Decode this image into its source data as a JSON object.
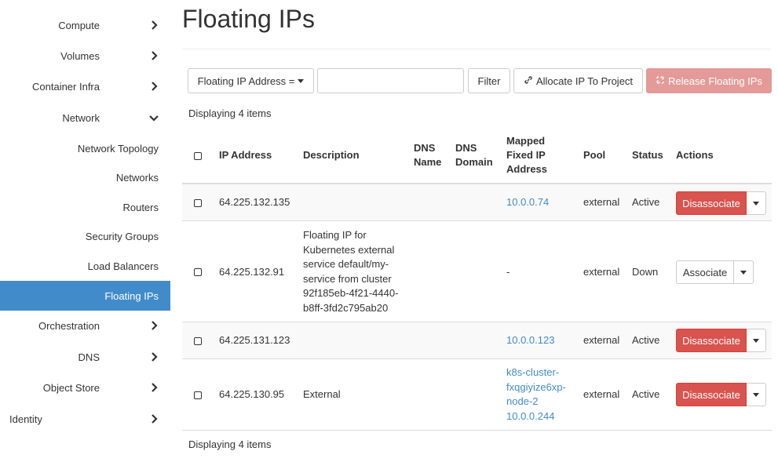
{
  "sidebar": {
    "items": [
      {
        "label": "Compute",
        "chevron": "right"
      },
      {
        "label": "Volumes",
        "chevron": "right"
      },
      {
        "label": "Container Infra",
        "chevron": "right"
      },
      {
        "label": "Network",
        "chevron": "down"
      },
      {
        "label": "Orchestration",
        "chevron": "right"
      },
      {
        "label": "DNS",
        "chevron": "right"
      },
      {
        "label": "Object Store",
        "chevron": "right"
      },
      {
        "label": "Identity",
        "chevron": "right"
      }
    ],
    "network_sub": [
      {
        "label": "Network Topology",
        "active": false
      },
      {
        "label": "Networks",
        "active": false
      },
      {
        "label": "Routers",
        "active": false
      },
      {
        "label": "Security Groups",
        "active": false
      },
      {
        "label": "Load Balancers",
        "active": false
      },
      {
        "label": "Floating IPs",
        "active": true
      }
    ]
  },
  "page": {
    "title": "Floating IPs"
  },
  "toolbar": {
    "filter_field": "Floating IP Address =",
    "filter_value": "",
    "filter_button": "Filter",
    "allocate_button": "Allocate IP To Project",
    "release_button": "Release Floating IPs",
    "allocate_icon": "link-icon",
    "release_icon": "unlink-icon"
  },
  "summary": {
    "top": "Displaying 4 items",
    "bottom": "Displaying 4 items"
  },
  "table": {
    "headers": {
      "ip": "IP Address",
      "description": "Description",
      "dns_name_1": "DNS",
      "dns_name_2": "Name",
      "dns_domain_1": "DNS",
      "dns_domain_2": "Domain",
      "mapped_1": "Mapped",
      "mapped_2": "Fixed IP",
      "mapped_3": "Address",
      "pool": "Pool",
      "status": "Status",
      "actions": "Actions"
    },
    "rows": [
      {
        "ip": "64.225.132.135",
        "description": [],
        "mapped": [
          "10.0.0.74"
        ],
        "mapped_is_link": true,
        "pool": "external",
        "status": "Active",
        "action": "Disassociate",
        "action_style": "danger"
      },
      {
        "ip": "64.225.132.91",
        "description": [
          "Floating IP for",
          "Kubernetes external",
          "service default/my-",
          "service from cluster",
          "92f185eb-4f21-4440-",
          "b8ff-3fd2c795ab20"
        ],
        "mapped": [
          "-"
        ],
        "mapped_is_link": false,
        "pool": "external",
        "status": "Down",
        "action": "Associate",
        "action_style": "default"
      },
      {
        "ip": "64.225.131.123",
        "description": [],
        "mapped": [
          "10.0.0.123"
        ],
        "mapped_is_link": true,
        "pool": "external",
        "status": "Active",
        "action": "Disassociate",
        "action_style": "danger"
      },
      {
        "ip": "64.225.130.95",
        "description": [
          "External"
        ],
        "mapped": [
          "k8s-cluster-",
          "fxqgiyize6xp-",
          "node-2",
          "10.0.0.244"
        ],
        "mapped_is_link": true,
        "pool": "external",
        "status": "Active",
        "action": "Disassociate",
        "action_style": "danger"
      }
    ]
  },
  "colors": {
    "active_nav": "#428bca",
    "link": "#428bca",
    "danger": "#d9534f",
    "danger_disabled": "#e39a98"
  }
}
